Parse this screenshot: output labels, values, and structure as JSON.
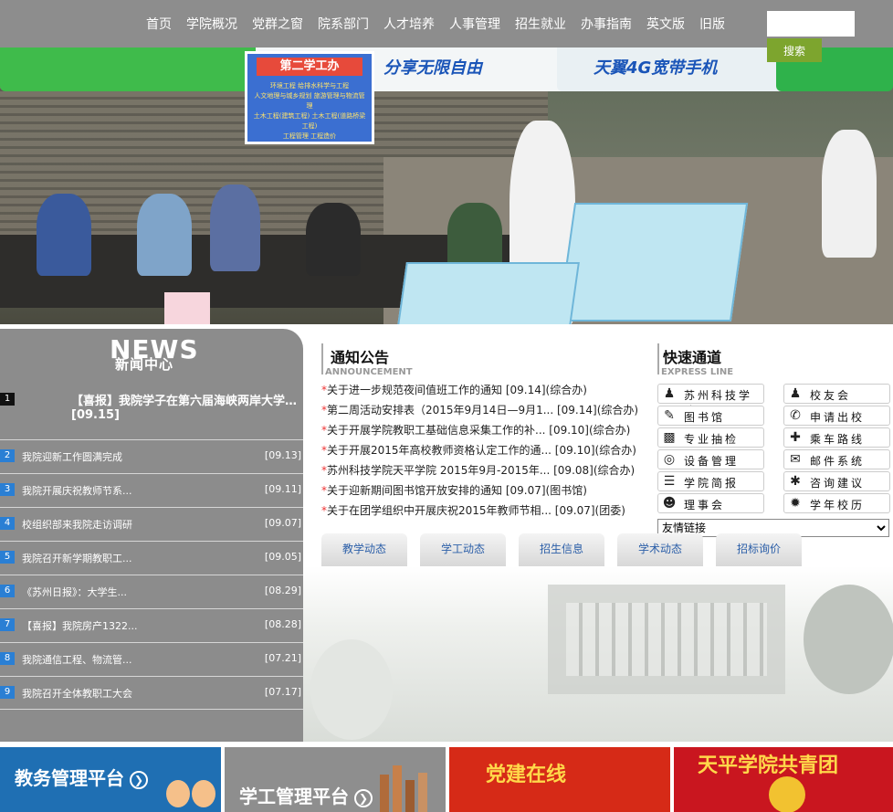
{
  "nav": {
    "items": [
      "首页",
      "学院概况",
      "党群之窗",
      "院系部门",
      "人才培养",
      "人事管理",
      "招生就业",
      "办事指南",
      "英文版",
      "旧版"
    ],
    "search_button": "搜索"
  },
  "banner": {
    "tent_texts": [
      "天翼4G宽带手机",
      "分享无限自由",
      "天翼4G宽带手机",
      "分享无限自由"
    ],
    "sign_title": "第二学工办",
    "sign_lines": [
      "环境工程 给排水科学与工程",
      "人文地理与城乡规划 旅游管理与物流管理",
      "土木工程(建筑工程) 土木工程(道路桥梁工程)",
      "工程管理 工程造价"
    ]
  },
  "news": {
    "title_en": "NEWS",
    "title_cn": "新闻中心",
    "featured": {
      "num": "1",
      "title": "【喜报】我院学子在第六届海峡两岸大学生孙...",
      "date": "[09.15]"
    },
    "items": [
      {
        "num": "2",
        "title": "我院迎新工作圆满完成",
        "date": "[09.13]"
      },
      {
        "num": "3",
        "title": "我院开展庆祝教师节系...",
        "date": "[09.11]"
      },
      {
        "num": "4",
        "title": "校组织部来我院走访调研",
        "date": "[09.07]"
      },
      {
        "num": "5",
        "title": "我院召开新学期教职工...",
        "date": "[09.05]"
      },
      {
        "num": "6",
        "title": "《苏州日报》：大学生...",
        "date": "[08.29]"
      },
      {
        "num": "7",
        "title": "【喜报】我院房产1322...",
        "date": "[08.28]"
      },
      {
        "num": "8",
        "title": "我院通信工程、物流管...",
        "date": "[07.21]"
      },
      {
        "num": "9",
        "title": "我院召开全体教职工大会",
        "date": "[07.17]"
      }
    ]
  },
  "notice": {
    "title": "通知公告",
    "subtitle": "ANNOUNCEMENT",
    "items": [
      "关于进一步规范夜间值班工作的通知 [09.14](综合办)",
      "第二周活动安排表（2015年9月14日—9月1... [09.14](综合办)",
      "关于开展学院教职工基础信息采集工作的补... [09.10](综合办)",
      "关于开展2015年高校教师资格认定工作的通... [09.10](综合办)",
      "苏州科技学院天平学院 2015年9月-2015年... [09.08](综合办)",
      "关于迎新期间图书馆开放安排的通知 [09.07](图书馆)",
      "关于在团学组织中开展庆祝2015年教师节相... [09.07](团委)"
    ]
  },
  "quick": {
    "title": "快速通道",
    "subtitle": "EXPRESS LINE",
    "left": [
      {
        "label": "苏州科技学院",
        "icon": "person-icon"
      },
      {
        "label": "图书馆",
        "icon": "pencil-icon"
      },
      {
        "label": "专业抽检",
        "icon": "chart-icon"
      },
      {
        "label": "设备管理",
        "icon": "target-icon"
      },
      {
        "label": "学院简报",
        "icon": "document-icon"
      },
      {
        "label": "理事会",
        "icon": "group-icon"
      }
    ],
    "right": [
      {
        "label": "校友会",
        "icon": "people-icon"
      },
      {
        "label": "申请出校",
        "icon": "phone-icon"
      },
      {
        "label": "乘车路线",
        "icon": "road-icon"
      },
      {
        "label": "邮件系统",
        "icon": "mail-icon"
      },
      {
        "label": "咨询建议",
        "icon": "star-icon"
      },
      {
        "label": "学年校历",
        "icon": "gear-icon"
      }
    ],
    "friend_links": "友情链接"
  },
  "tabs": [
    "教学动态",
    "学工动态",
    "招生信息",
    "学术动态",
    "招标询价"
  ],
  "platforms": [
    {
      "label": "教务管理平台",
      "color": "#1f6fb3"
    },
    {
      "label": "学工管理平台",
      "color": "#8e8e8e"
    },
    {
      "label": "党建在线",
      "color": "#d62a17"
    },
    {
      "label": "天平学院共青团",
      "color": "#c9161f"
    }
  ]
}
